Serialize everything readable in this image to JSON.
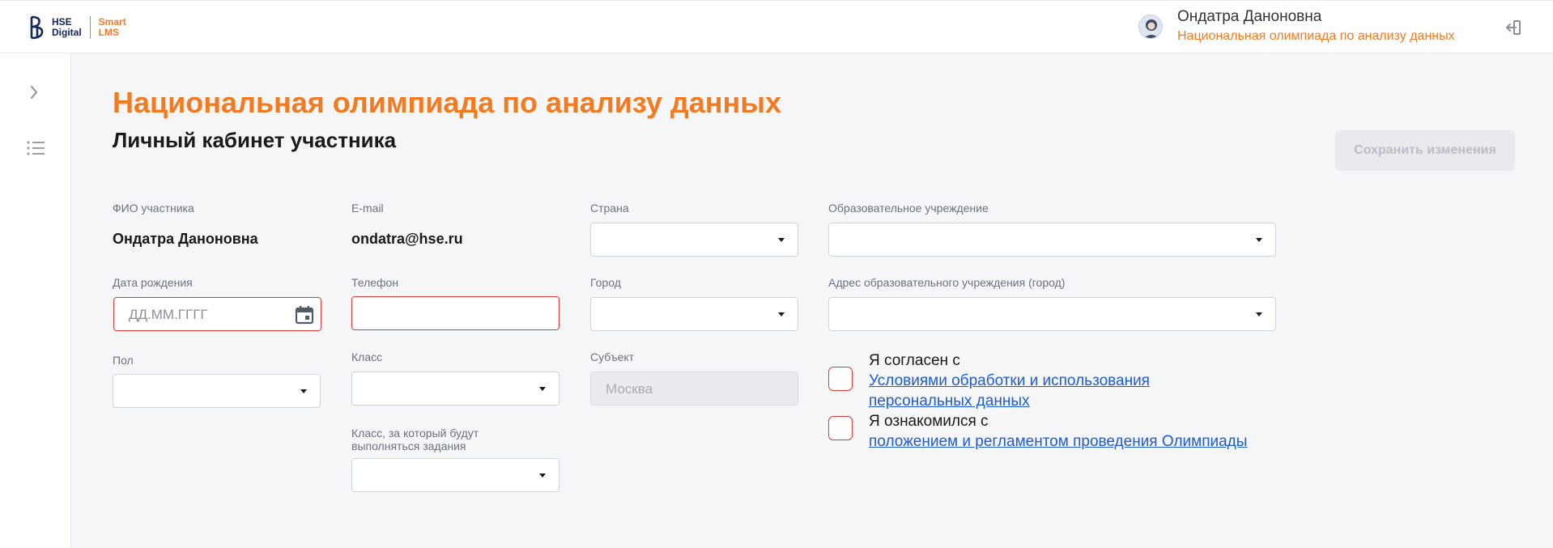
{
  "header": {
    "logo_line1": "HSE",
    "logo_line2": "Digital",
    "logo_smart1": "Smart",
    "logo_smart2": "LMS",
    "user_name": "Ондатра Даноновна",
    "user_course": "Национальная олимпиада по анализу данных"
  },
  "page": {
    "title": "Национальная олимпиада по анализу данных",
    "subtitle": "Личный кабинет участника",
    "save_label": "Сохранить изменения"
  },
  "form": {
    "fio_label": "ФИО участника",
    "fio_value": "Ондатра Даноновна",
    "email_label": "E-mail",
    "email_value": "ondatra@hse.ru",
    "country_label": "Страна",
    "country_value": "",
    "edu_label": "Образовательное учреждение",
    "edu_value": "",
    "birth_label": "Дата рождения",
    "birth_placeholder": "ДД.ММ.ГГГГ",
    "phone_label": "Телефон",
    "phone_value": "",
    "city_label": "Город",
    "city_value": "",
    "edu_address_label": "Адрес образовательного учреждения (город)",
    "edu_address_value": "",
    "gender_label": "Пол",
    "gender_value": "",
    "grade_label": "Класс",
    "grade_value": "",
    "subject_label": "Субъект",
    "subject_value": "Москва",
    "task_grade_label_1": "Класс, за который будут",
    "task_grade_label_2": "выполняться задания",
    "task_grade_value": ""
  },
  "consents": {
    "pd_prefix": "Я согласен с",
    "pd_link_1": "Условиями обработки и использования",
    "pd_link_2": "персональных данных",
    "rules_prefix": "Я ознакомился с",
    "rules_link": "положением и регламентом проведения Олимпиады"
  },
  "colors": {
    "accent": "#f47a20",
    "error": "#e53935",
    "link": "#1e5bd8",
    "brand_dark": "#10275b"
  },
  "icons": {
    "logo": "hse-logo-icon",
    "avatar": "user-avatar",
    "logout": "logout-icon",
    "sidebar_expand": "chevron-right-icon",
    "sidebar_list": "list-icon",
    "calendar": "calendar-icon",
    "dropdown": "caret-down-icon"
  }
}
